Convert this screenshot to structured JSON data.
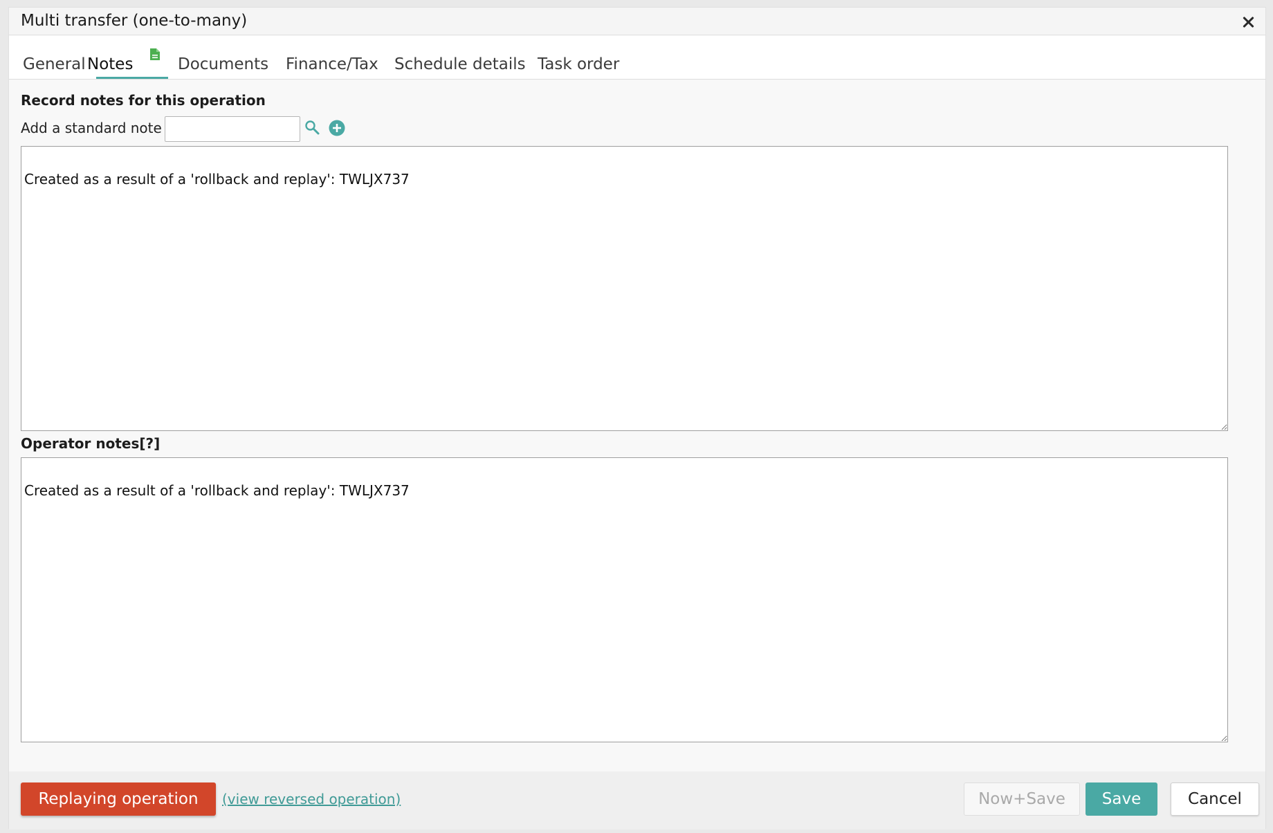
{
  "window": {
    "title": "Multi transfer (one-to-many)",
    "close_icon": "close-icon"
  },
  "tabs": [
    {
      "label": "General",
      "active": false
    },
    {
      "label": "Notes",
      "active": true,
      "badge_icon": "document-icon"
    },
    {
      "label": "Documents",
      "active": false
    },
    {
      "label": "Finance/Tax",
      "active": false
    },
    {
      "label": "Schedule details",
      "active": false
    },
    {
      "label": "Task order",
      "active": false
    }
  ],
  "notes": {
    "record_heading": "Record notes for this operation",
    "standard_note_label": "Add a standard note",
    "standard_note_value": "",
    "record_text": "Created as a result of a 'rollback and replay': TWLJX737",
    "operator_heading": "Operator notes[?]",
    "operator_text": "Created as a result of a 'rollback and replay': TWLJX737"
  },
  "footer": {
    "replay_label": "Replaying operation",
    "view_reversed_label": "(view reversed operation)",
    "now_save_label": "Now+Save",
    "save_label": "Save",
    "cancel_label": "Cancel"
  },
  "colors": {
    "accent": "#4aa9a4",
    "danger": "#d2462a",
    "note_icon": "#4caf50"
  }
}
